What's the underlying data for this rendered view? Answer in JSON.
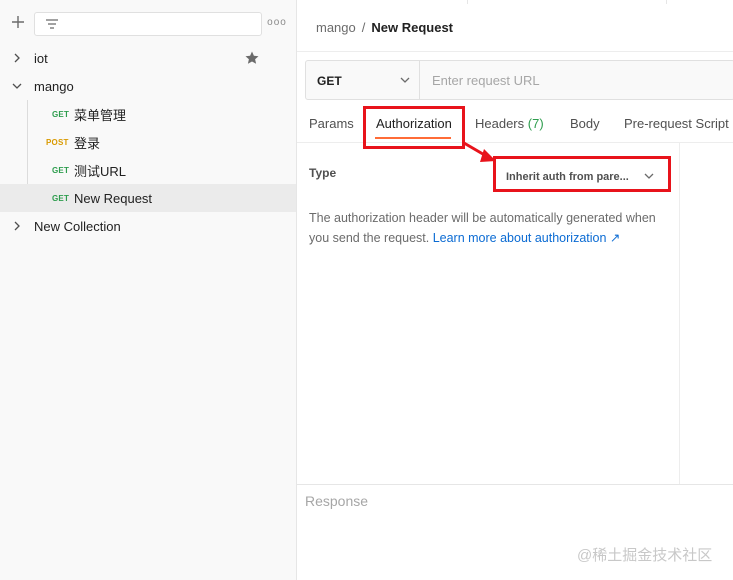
{
  "sidebar": {
    "new_button_icon": "plus-icon",
    "filter_icon": "filter-icon",
    "more_icon": "more-dots-icon",
    "more_label": "ooo",
    "tree": [
      {
        "label": "iot",
        "expanded": false,
        "starred": true
      },
      {
        "label": "mango",
        "expanded": true,
        "requests": [
          {
            "method": "GET",
            "name": "菜单管理"
          },
          {
            "method": "POST",
            "name": "登录"
          },
          {
            "method": "GET",
            "name": "测试URL"
          },
          {
            "method": "GET",
            "name": "New Request",
            "selected": true
          }
        ]
      },
      {
        "label": "New Collection",
        "expanded": false
      }
    ]
  },
  "main": {
    "breadcrumb": {
      "parent": "mango",
      "separator": "/",
      "current": "New Request"
    },
    "request": {
      "method": "GET",
      "url_placeholder": "Enter request URL",
      "url_value": ""
    },
    "tabs": {
      "params": "Params",
      "authorization": "Authorization",
      "headers": "Headers",
      "headers_count": "(7)",
      "body": "Body",
      "prerequest": "Pre-request Script"
    },
    "auth": {
      "type_label": "Type",
      "type_value": "Inherit auth from pare...",
      "description": "The authorization header will be automatically generated when you send the request. ",
      "link_text": "Learn more about authorization ↗"
    },
    "response_label": "Response",
    "watermark": "@稀土掘金技术社区"
  },
  "colors": {
    "accent": "#ff6c37",
    "get": "#2e9d4e",
    "post": "#d99a00",
    "link": "#0b6bd3",
    "annotation": "#e8131b"
  }
}
